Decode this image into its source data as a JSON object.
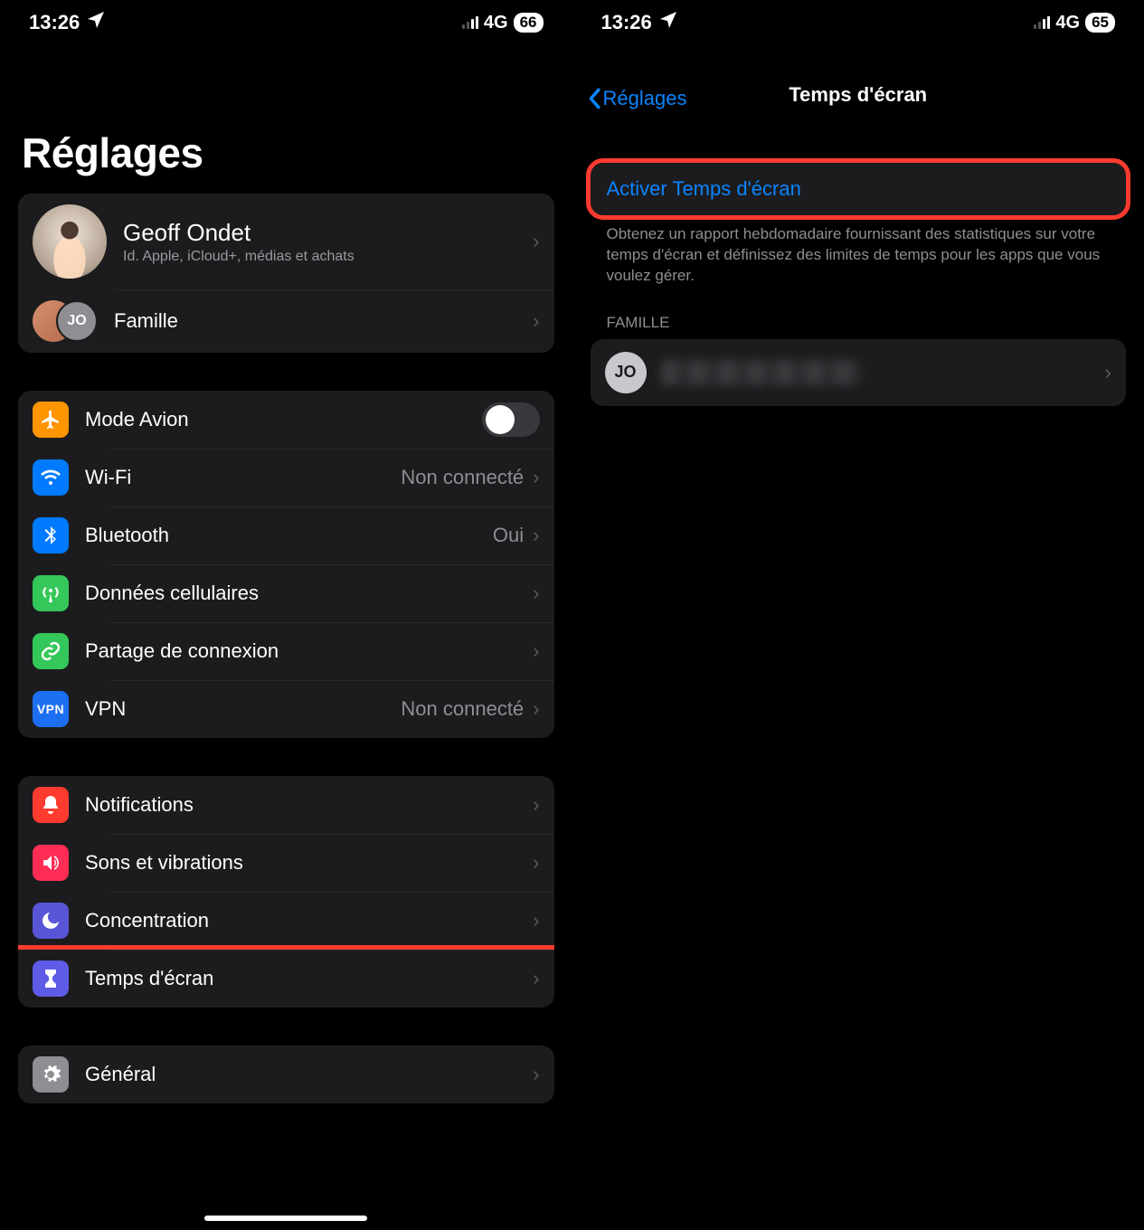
{
  "left": {
    "status": {
      "time": "13:26",
      "network": "4G",
      "battery": "66"
    },
    "title": "Réglages",
    "account": {
      "name": "Geoff Ondet",
      "subtitle": "Id. Apple, iCloud+, médias et achats",
      "family": {
        "label": "Famille",
        "initials": "JO"
      }
    },
    "connectivity": [
      {
        "icon": "airplane",
        "label": "Mode Avion",
        "toggle": true,
        "color": "ic-orange"
      },
      {
        "icon": "wifi",
        "label": "Wi-Fi",
        "value": "Non connecté",
        "color": "ic-blue"
      },
      {
        "icon": "bluetooth",
        "label": "Bluetooth",
        "value": "Oui",
        "color": "ic-blue"
      },
      {
        "icon": "antenna",
        "label": "Données cellulaires",
        "color": "ic-green"
      },
      {
        "icon": "link",
        "label": "Partage de connexion",
        "color": "ic-green"
      },
      {
        "icon": "vpn",
        "label": "VPN",
        "value": "Non connecté",
        "color": "ic-vpn",
        "text_icon": "VPN"
      }
    ],
    "preferences": [
      {
        "icon": "bell",
        "label": "Notifications",
        "color": "ic-red"
      },
      {
        "icon": "speaker",
        "label": "Sons et vibrations",
        "color": "ic-pink"
      },
      {
        "icon": "moon",
        "label": "Concentration",
        "color": "ic-indigo"
      },
      {
        "icon": "hourglass",
        "label": "Temps d'écran",
        "color": "ic-purple",
        "highlight": true
      }
    ],
    "general": [
      {
        "icon": "gear",
        "label": "Général",
        "color": "ic-gray"
      }
    ]
  },
  "right": {
    "status": {
      "time": "13:26",
      "network": "4G",
      "battery": "65"
    },
    "back": "Réglages",
    "title": "Temps d'écran",
    "activate": "Activer Temps d'écran",
    "note": "Obtenez un rapport hebdomadaire fournissant des statistiques sur votre temps d'écran et définissez des limites de temps pour les apps que vous voulez gérer.",
    "family_header": "FAMILLE",
    "family_initials": "JO"
  }
}
